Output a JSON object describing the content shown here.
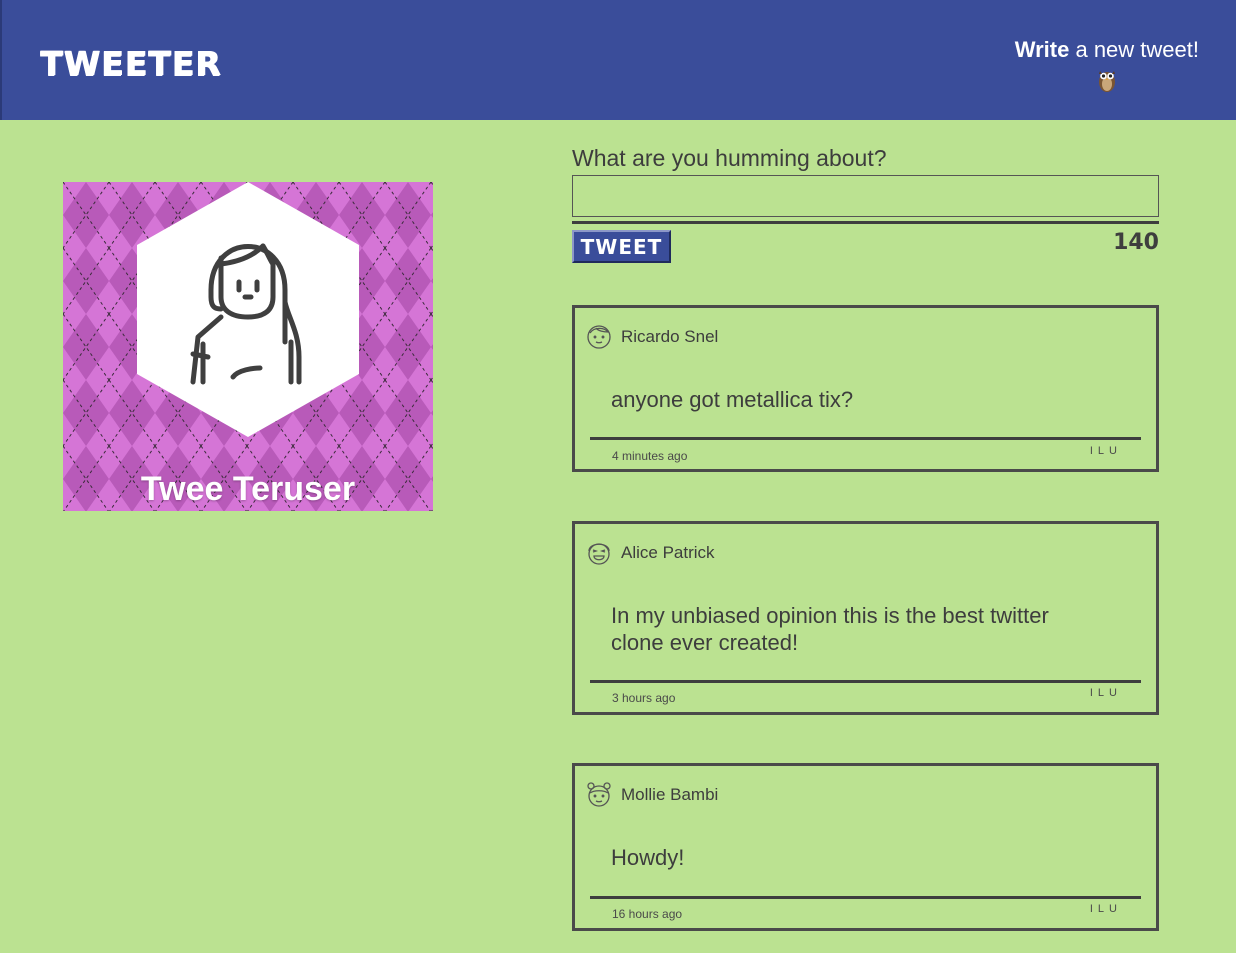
{
  "nav": {
    "brand": "TWEETER",
    "compose_bold": "Write",
    "compose_rest": " a new tweet!",
    "compose_icon": "owl-icon"
  },
  "profile": {
    "name": "Twee Teruser",
    "background_color": "#cf6bd0",
    "avatar_icon": "user-avatar-icon"
  },
  "compose": {
    "label": "What are you humming about?",
    "value": "",
    "placeholder": "",
    "button_label": "TWEET",
    "counter": "140"
  },
  "tweets": [
    {
      "author": "Ricardo Snel",
      "text": "anyone got metallica tix?",
      "time": "4 minutes ago",
      "actions": [
        "I",
        "L",
        "U"
      ],
      "avatar_icon": "face-icon"
    },
    {
      "author": "Alice Patrick",
      "text": "In my unbiased opinion this is the best twitter clone ever created!",
      "time": "3 hours ago",
      "actions": [
        "I",
        "L",
        "U"
      ],
      "avatar_icon": "laughing-face-icon"
    },
    {
      "author": "Mollie Bambi",
      "text": "Howdy!",
      "time": "16 hours ago",
      "actions": [
        "I",
        "L",
        "U"
      ],
      "avatar_icon": "girl-face-icon"
    }
  ],
  "colors": {
    "nav": "#3a4d9a",
    "background": "#bbe291",
    "text": "#4a4a4a"
  }
}
